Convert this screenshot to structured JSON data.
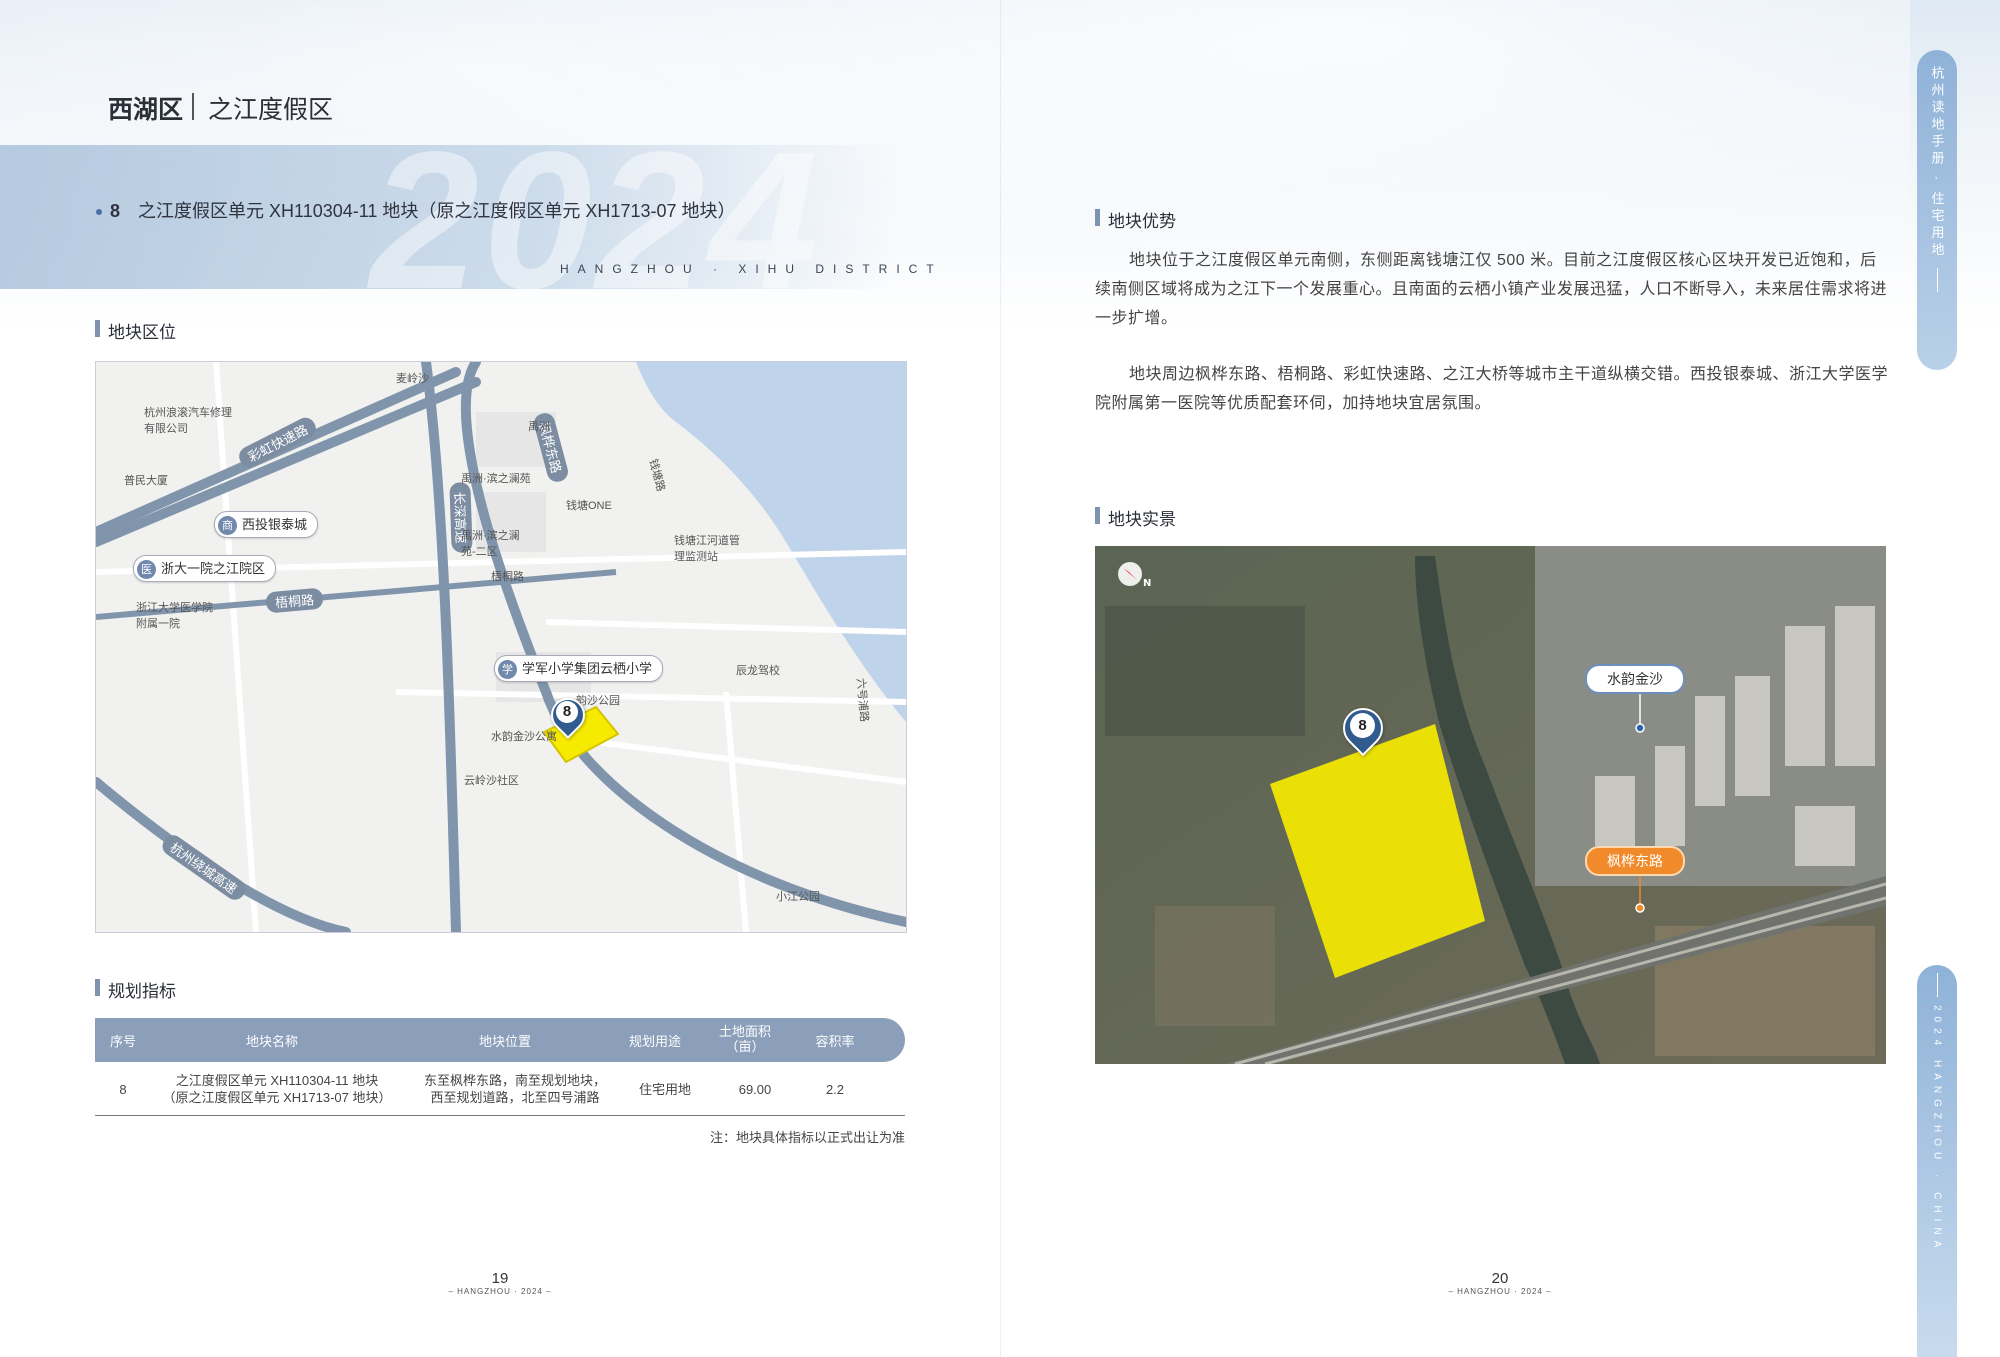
{
  "header": {
    "district": "西湖区",
    "area": "之江度假区",
    "year_watermark": "2024",
    "district_en": "HANGZHOU · XIHU DISTRICT"
  },
  "parcel": {
    "number": "8",
    "title": "之江度假区单元 XH110304-11 地块（原之江度假区单元 XH1713-07 地块）"
  },
  "sections": {
    "location": "地块区位",
    "indicators": "规划指标",
    "advantages": "地块优势",
    "real_view": "地块实景"
  },
  "map": {
    "pin_number": "8",
    "roads": {
      "caihong": "彩虹快速路",
      "wutong": "梧桐路",
      "changzhu": "长深高速",
      "fenghua": "枫桦东路",
      "hangzhou_ring": "杭州绕城高速",
      "qiantang": "钱塘路",
      "liuhao": "六号浦路"
    },
    "pois": {
      "yintai": "西投银泰城",
      "hospital": "浙大一院之江院区",
      "school": "学军小学集团云栖小学"
    },
    "labels": {
      "auto": "杭州浪滚汽车修理有限公司",
      "yimin": "普民大厦",
      "zju": "浙江大学医学院附属一院",
      "yuzhou1": "禹洲·滨之澜苑",
      "yuzhou2": "禹洲·滨之澜苑-二区",
      "qiantang_one": "钱塘ONE",
      "monitor": "钱塘江河道管理监测站",
      "chenlong": "辰龙驾校",
      "shuiyun_park": "水韵金沙公寓",
      "jinsha_park": "韵沙公园",
      "community": "云岭沙社区",
      "xiaojiang": "小江公园",
      "dongkan": "麦岭沙",
      "yuzhou": "禹洲",
      "wutong_small": "梧桐路"
    }
  },
  "table": {
    "headers": [
      "序号",
      "地块名称",
      "地块位置",
      "规划用途",
      "土地面积\n（亩）",
      "容积率"
    ],
    "row": {
      "no": "8",
      "name1": "之江度假区单元 XH110304-11 地块",
      "name2": "（原之江度假区单元 XH1713-07 地块）",
      "loc1": "东至枫桦东路，南至规划地块，",
      "loc2": "西至规划道路，北至四号浦路",
      "use": "住宅用地",
      "area": "69.00",
      "far": "2.2"
    },
    "note": "注：地块具体指标以正式出让为准"
  },
  "advantages": {
    "p1": "地块位于之江度假区单元南侧，东侧距离钱塘江仅 500 米。目前之江度假区核心区块开发已近饱和，后续南侧区域将成为之江下一个发展重心。且南面的云栖小镇产业发展迅猛，人口不断导入，未来居住需求将进一步扩增。",
    "p2": "地块周边枫桦东路、梧桐路、彩虹快速路、之江大桥等城市主干道纵横交错。西投银泰城、浙江大学医学院附属第一医院等优质配套环伺，加持地块宜居氛围。"
  },
  "aerial": {
    "pin_number": "8",
    "tag_white": "水韵金沙",
    "tag_orange": "枫桦东路",
    "compass": "N"
  },
  "pages": {
    "left": {
      "num": "19",
      "sub": "– HANGZHOU · 2024 –"
    },
    "right": {
      "num": "20",
      "sub": "– HANGZHOU · 2024 –"
    }
  },
  "side": {
    "top": "杭州读地手册 · 住宅用地",
    "bottom": "2024 HANGZHOU · CHINA"
  },
  "colors": {
    "accent": "#8b9fba",
    "pin": "#315b8f",
    "parcel": "#f5ea00",
    "tag_orange": "#f18a2a"
  }
}
